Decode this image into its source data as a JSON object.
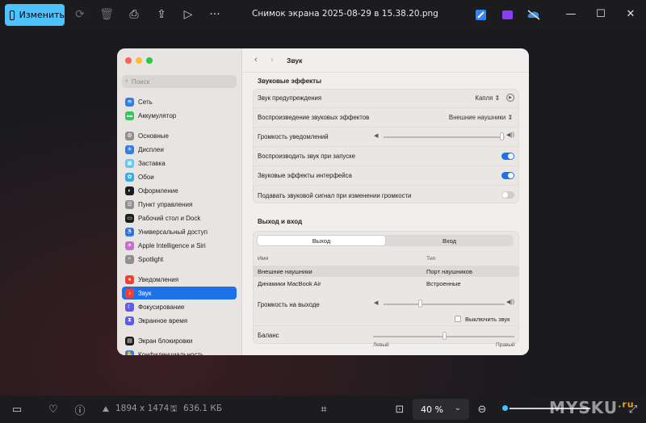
{
  "toolbar": {
    "edit_label": "Изменить",
    "filename": "Снимок экрана 2025-08-29 в 15.38.20.png"
  },
  "bottom": {
    "dimensions": "1894 x 1474",
    "filesize": "636.1 КБ",
    "zoom": "40 %"
  },
  "watermark": {
    "main": "MYSKU",
    "suffix": ".ru"
  },
  "mac": {
    "search_placeholder": "Поиск",
    "sidebar": [
      {
        "label": "Сеть",
        "icon": "wifi-icon",
        "color": "#2f7ef0"
      },
      {
        "label": "Аккумулятор",
        "icon": "battery-icon",
        "color": "#34c759"
      },
      {
        "label": "Основные",
        "icon": "gear-icon",
        "color": "#8e8e93"
      },
      {
        "label": "Дисплеи",
        "icon": "sun-icon",
        "color": "#2f7ef0"
      },
      {
        "label": "Заставка",
        "icon": "screensaver-icon",
        "color": "#5ac8fa"
      },
      {
        "label": "Обои",
        "icon": "wallpaper-icon",
        "color": "#32ade6"
      },
      {
        "label": "Оформление",
        "icon": "appearance-icon",
        "color": "#1c1c1e"
      },
      {
        "label": "Пункт управления",
        "icon": "control-center-icon",
        "color": "#8e8e93"
      },
      {
        "label": "Рабочий стол и Dock",
        "icon": "dock-icon",
        "color": "#1c1c1e"
      },
      {
        "label": "Универсальный доступ",
        "icon": "accessibility-icon",
        "color": "#2f7ef0"
      },
      {
        "label": "Apple Intelligence и Siri",
        "icon": "siri-icon",
        "color": "#c86dd7"
      },
      {
        "label": "Spotlight",
        "icon": "spotlight-icon",
        "color": "#8e8e93"
      },
      {
        "label": "Уведомления",
        "icon": "bell-icon",
        "color": "#ff3b30"
      },
      {
        "label": "Звук",
        "icon": "speaker-icon",
        "color": "#ff3b30"
      },
      {
        "label": "Фокусирование",
        "icon": "moon-icon",
        "color": "#5e5ce6"
      },
      {
        "label": "Экранное время",
        "icon": "hourglass-icon",
        "color": "#5e5ce6"
      },
      {
        "label": "Экран блокировки",
        "icon": "lock-screen-icon",
        "color": "#1c1c1e"
      },
      {
        "label": "Конфиденциальность",
        "icon": "hand-icon",
        "color": "#2f7ef0"
      }
    ],
    "header_title": "Звук",
    "effects": {
      "section": "Звуковые эффекты",
      "alert_sound_label": "Звук предупреждения",
      "alert_sound_value": "Капля",
      "play_effects_label": "Воспроизведение звуковых эффектов",
      "play_effects_value": "Внешние наушники",
      "alert_volume_label": "Громкость уведомлений",
      "alert_volume_level": 0.97,
      "startup_label": "Воспроизводить звук при запуске",
      "startup_on": true,
      "ui_effects_label": "Звуковые эффекты интерфейса",
      "ui_effects_on": true,
      "feedback_label": "Подавать звуковой сигнал при изменении громкости",
      "feedback_on": false
    },
    "io": {
      "section": "Выход и вход",
      "tab_output": "Выход",
      "tab_input": "Вход",
      "col_name": "Имя",
      "col_type": "Тип",
      "rows": [
        {
          "name": "Внешние наушники",
          "type": "Порт наушников"
        },
        {
          "name": "Динамики MacBook Air",
          "type": "Встроенные"
        }
      ],
      "output_volume_label": "Громкость на выходе",
      "output_volume_level": 0.3,
      "mute_label": "Выключить звук",
      "balance_label": "Баланс",
      "balance_left": "Левый",
      "balance_right": "Правый",
      "balance_level": 0.5
    }
  }
}
